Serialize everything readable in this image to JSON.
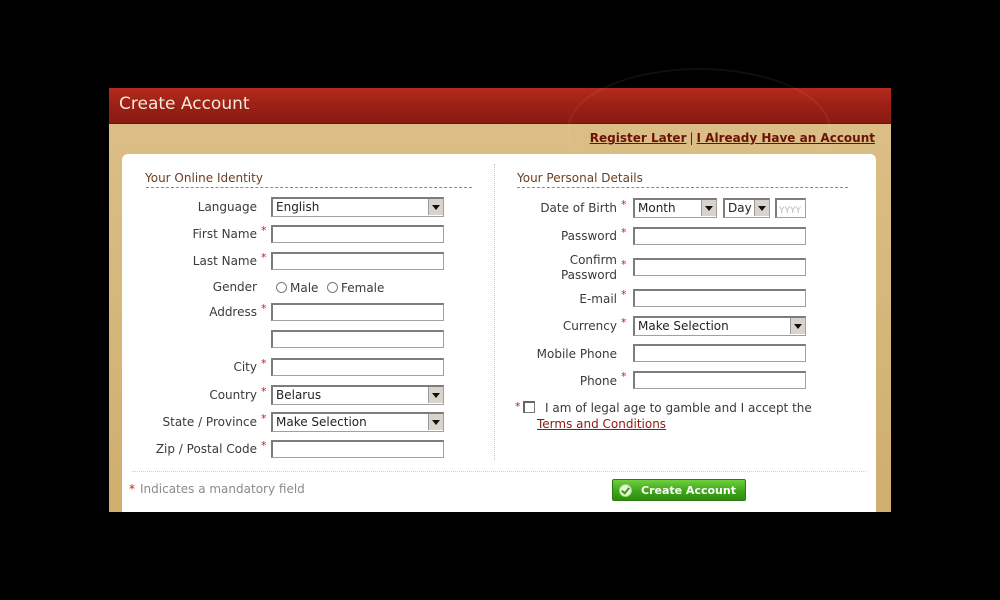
{
  "title": "Create Account",
  "links": {
    "register_later": "Register Later",
    "separator": "|",
    "already_have": "I Already Have an Account"
  },
  "left": {
    "section_title": "Your Online Identity",
    "language_label": "Language",
    "language_value": "English",
    "first_name_label": "First Name",
    "last_name_label": "Last Name",
    "gender_label": "Gender",
    "gender_male": "Male",
    "gender_female": "Female",
    "address_label": "Address",
    "city_label": "City",
    "country_label": "Country",
    "country_value": "Belarus",
    "state_label": "State / Province",
    "state_value": "Make Selection",
    "zip_label": "Zip / Postal Code"
  },
  "right": {
    "section_title": "Your Personal Details",
    "dob_label": "Date of Birth",
    "dob_month": "Month",
    "dob_day": "Day",
    "dob_year_placeholder": "YYYY",
    "password_label": "Password",
    "confirm_label_1": "Confirm",
    "confirm_label_2": "Password",
    "email_label": "E-mail",
    "currency_label": "Currency",
    "currency_value": "Make Selection",
    "mobile_label": "Mobile Phone",
    "phone_label": "Phone",
    "terms_text": "I am of legal age to gamble and I accept the",
    "terms_link": "Terms and Conditions"
  },
  "footer": {
    "mandatory_star": "*",
    "mandatory_text": "Indicates a mandatory field",
    "create_button": "Create Account"
  },
  "required_mark": "*",
  "colors": {
    "header_red": "#a0231a",
    "panel_tan": "#d6b97d",
    "button_green": "#3fa51a",
    "required_red": "#c0201a"
  }
}
